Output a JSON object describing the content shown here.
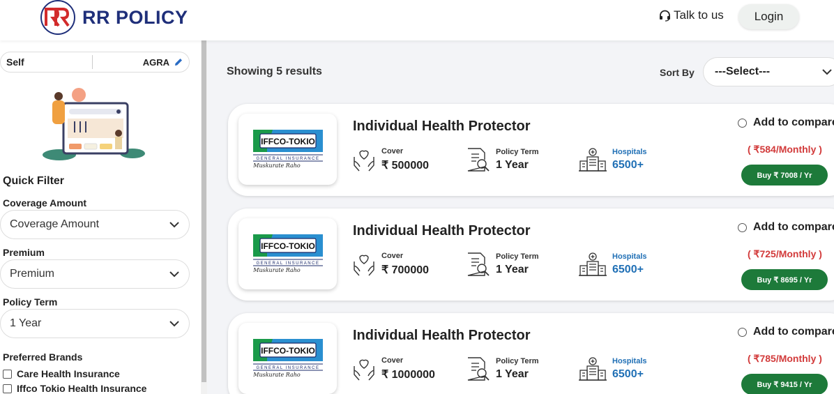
{
  "header": {
    "brand": "RR POLICY",
    "talk_label": "Talk to us",
    "login_label": "Login"
  },
  "sidebar": {
    "self_label": "Self",
    "city": "AGRA",
    "quick_filter_title": "Quick Filter",
    "filters": [
      {
        "label": "Coverage Amount",
        "value": "Coverage Amount"
      },
      {
        "label": "Premium",
        "value": "Premium"
      },
      {
        "label": "Policy Term",
        "value": "1 Year"
      }
    ],
    "brands_title": "Preferred Brands",
    "brands": [
      "Care Health Insurance",
      "Iffco Tokio Health Insurance"
    ]
  },
  "main": {
    "results_text": "Showing 5 results",
    "sort_label": "Sort By",
    "sort_value": "---Select---"
  },
  "card_labels": {
    "cover": "Cover",
    "term": "Policy Term",
    "hospitals": "Hospitals",
    "compare": "Add to compare"
  },
  "insurer_logo": {
    "name": "IFFCO-TOKIO",
    "sub": "GENERAL INSURANCE",
    "tagline": "Muskurate Raho"
  },
  "plans": [
    {
      "name": "Individual Health Protector",
      "cover": "₹ 500000",
      "term": "1 Year",
      "hospitals": "6500+",
      "monthly": "( ₹584/Monthly )",
      "buy": "Buy ₹ 7008 / Yr"
    },
    {
      "name": "Individual Health Protector",
      "cover": "₹ 700000",
      "term": "1 Year",
      "hospitals": "6500+",
      "monthly": "( ₹725/Monthly )",
      "buy": "Buy ₹ 8695 / Yr"
    },
    {
      "name": "Individual Health Protector",
      "cover": "₹ 1000000",
      "term": "1 Year",
      "hospitals": "6500+",
      "monthly": "( ₹785/Monthly )",
      "buy": "Buy ₹ 9415 / Yr"
    }
  ],
  "colors": {
    "brand": "#1f2f7a",
    "buy_green": "#1d7a3a",
    "price_red": "#d23a3a",
    "hospital_blue": "#1f6fb5"
  },
  "icons": [
    "headset-icon",
    "pencil-icon",
    "chevron-down-icon",
    "hands-heart-icon",
    "document-search-icon",
    "hospital-icon"
  ]
}
